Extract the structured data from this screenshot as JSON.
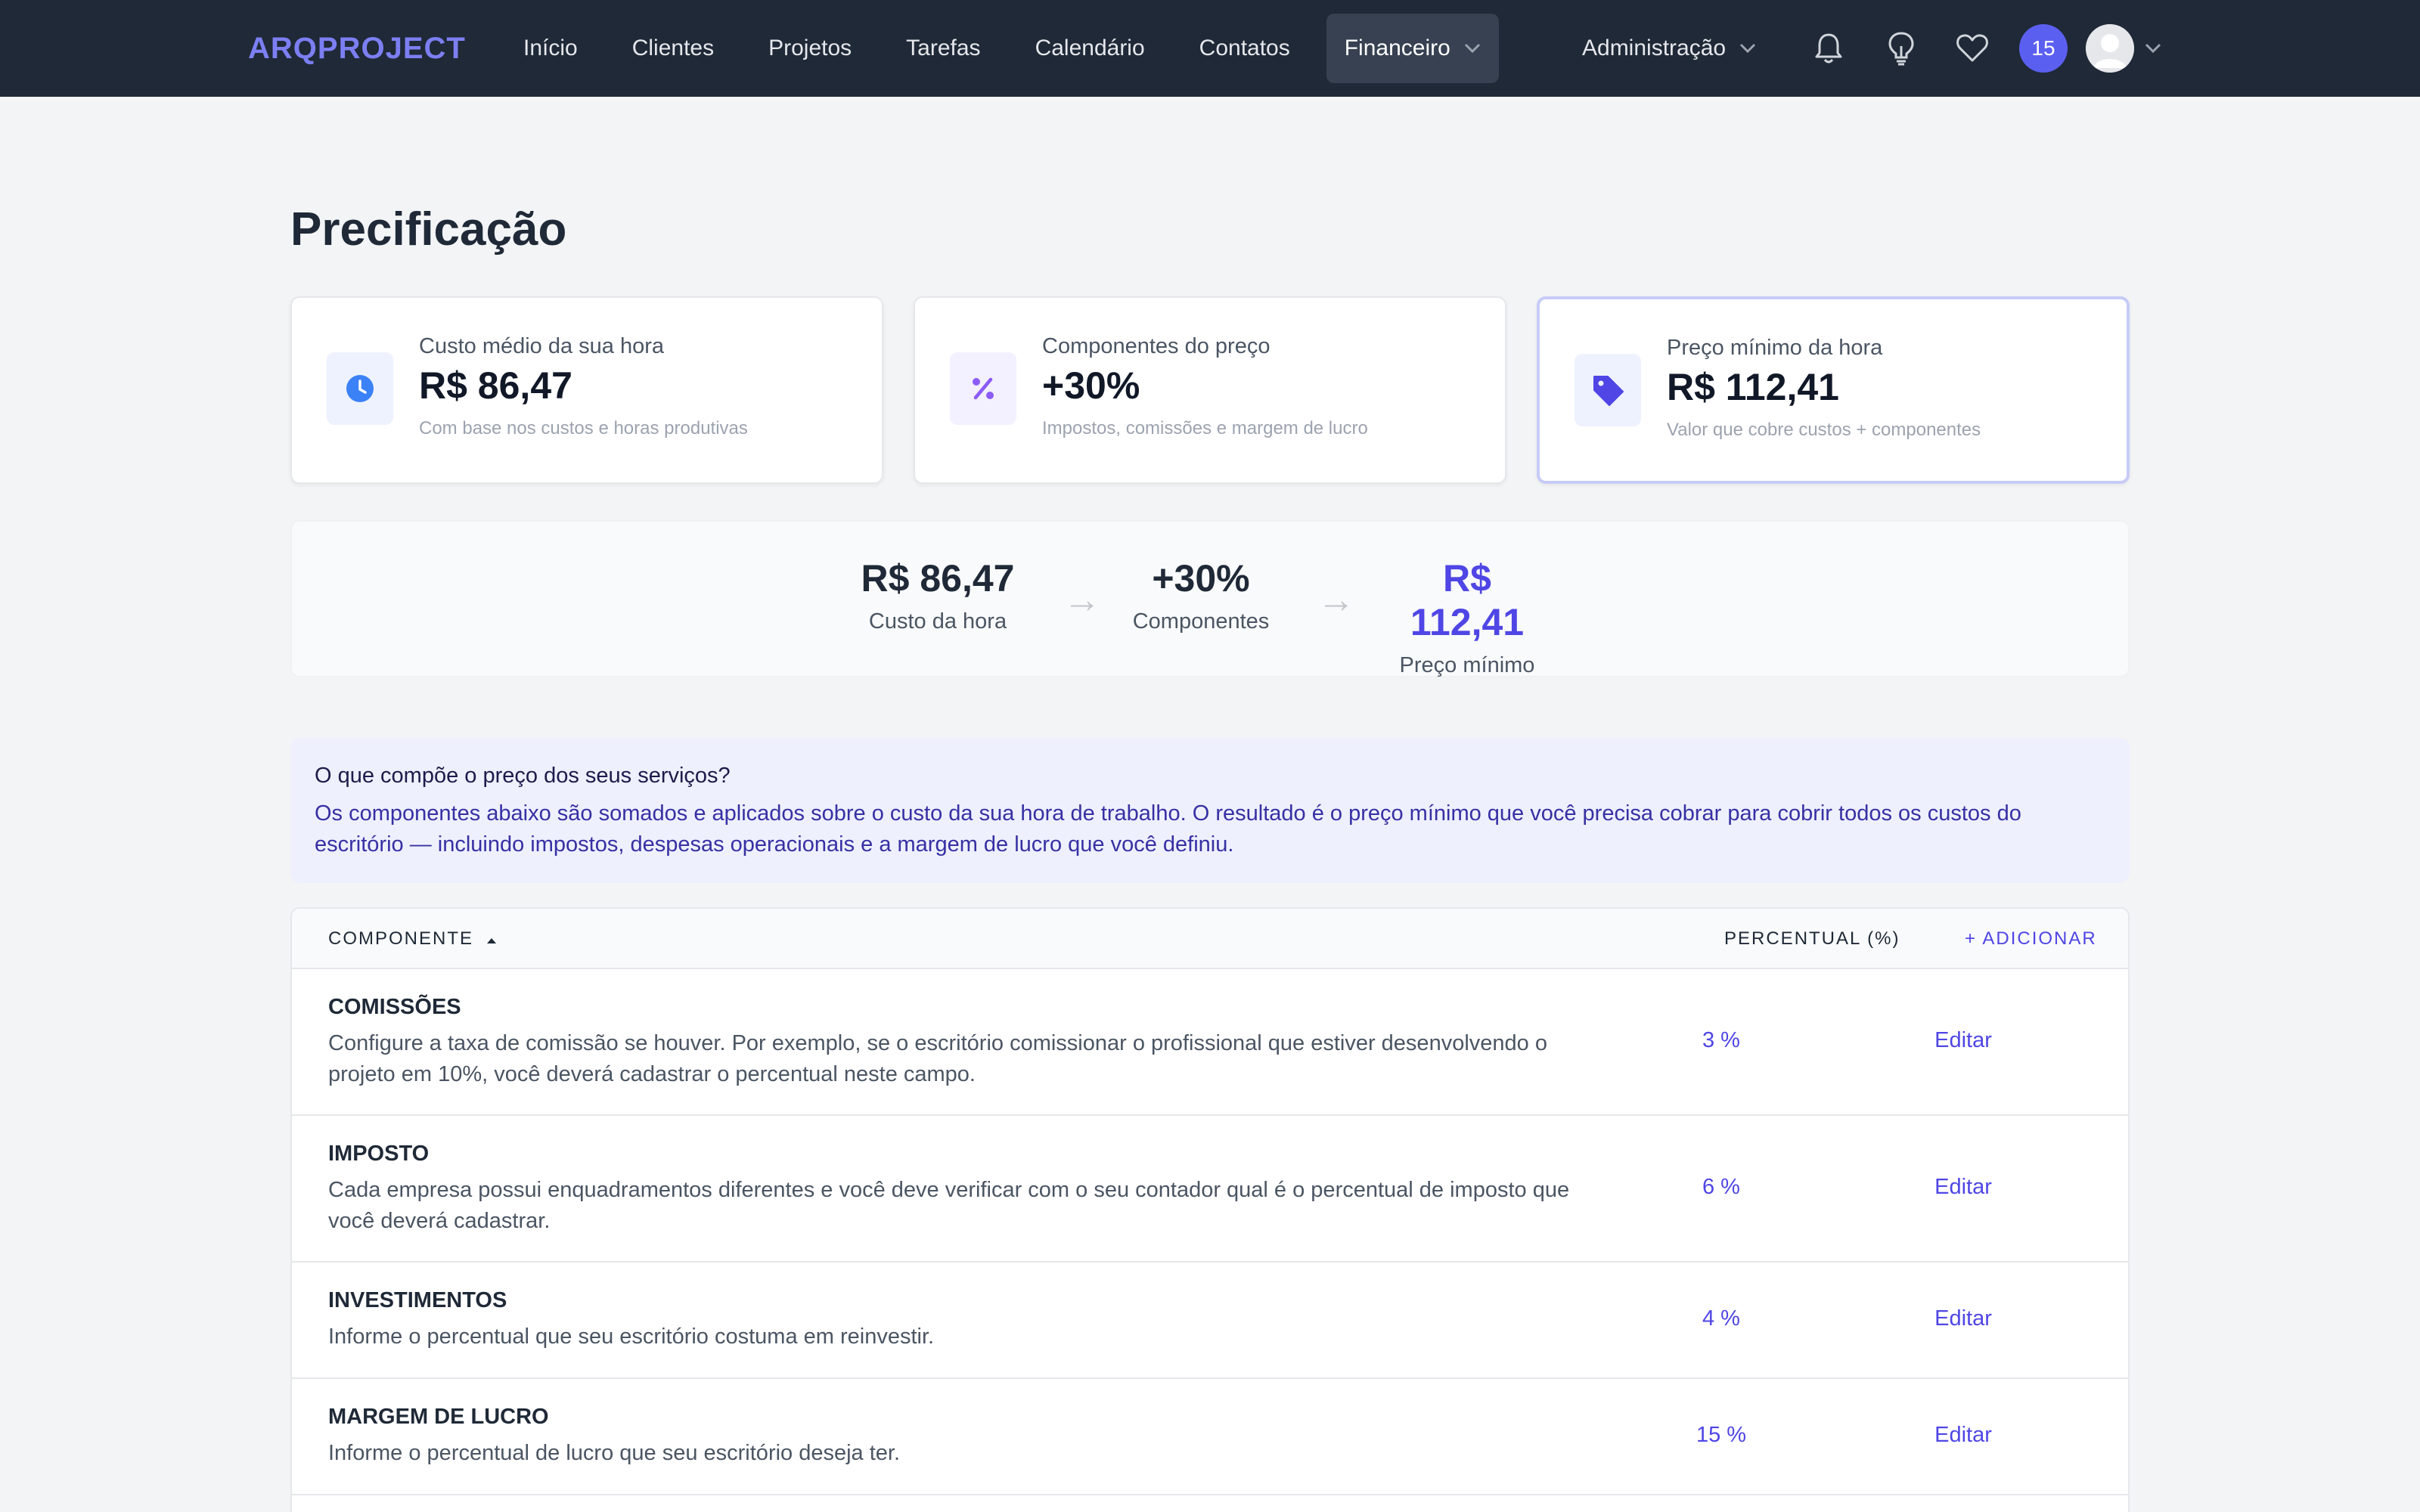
{
  "nav": {
    "logo": "ARQPROJECT",
    "links": [
      "Início",
      "Clientes",
      "Projetos",
      "Tarefas",
      "Calendário",
      "Contatos"
    ],
    "financeiro": "Financeiro",
    "admin": "Administração",
    "notification_count": "15",
    "icons": [
      "bell-icon",
      "lightbulb-icon",
      "heart-icon",
      "user-avatar",
      "chevron-down-icon"
    ]
  },
  "page": {
    "title": "Precificação"
  },
  "cards": [
    {
      "label": "Custo médio da sua hora",
      "value": "R$ 86,47",
      "sub": "Com base nos custos e horas produtivas",
      "icon": "clock-icon",
      "icon_bg": "#eef2ff",
      "icon_color": "#3b82f6"
    },
    {
      "label": "Componentes do preço",
      "value": "+30%",
      "sub": "Impostos, comissões e margem de lucro",
      "icon": "percent-icon",
      "icon_bg": "#f3f0ff",
      "icon_color": "#8b5cf6"
    },
    {
      "label": "Preço mínimo da hora",
      "value": "R$ 112,41",
      "sub": "Valor que cobre custos + componentes",
      "icon": "tag-icon",
      "icon_bg": "#eef2ff",
      "icon_color": "#4f46e5"
    }
  ],
  "formula": {
    "cost_value": "R$ 86,47",
    "cost_label": "Custo da hora",
    "arrow": "→",
    "comp_value": "+30%",
    "comp_label": "Componentes",
    "price_value": "R$ 112,41",
    "price_label": "Preço mínimo"
  },
  "info": {
    "title": "O que compõe o preço dos seus serviços?",
    "body": "Os componentes abaixo são somados e aplicados sobre o custo da sua hora de trabalho. O resultado é o preço mínimo que você precisa cobrar para cobrir todos os custos do escritório — incluindo impostos, despesas operacionais e a margem de lucro que você definiu."
  },
  "table": {
    "col_component": "COMPONENTE",
    "col_percent": "PERCENTUAL (%)",
    "add": "+ ADICIONAR",
    "rows": [
      {
        "title": "COMISSÕES",
        "desc": "Configure a taxa de comissão se houver. Por exemplo, se o escritório comissionar o profissional que estiver desenvolvendo o projeto em 10%, você deverá cadastrar o percentual neste campo.",
        "pct": "3 %",
        "edit": "Editar"
      },
      {
        "title": "IMPOSTO",
        "desc": "Cada empresa possui enquadramentos diferentes e você deve verificar com o seu contador qual é o percentual de imposto que você deverá cadastrar.",
        "pct": "6 %",
        "edit": "Editar"
      },
      {
        "title": "INVESTIMENTOS",
        "desc": "Informe o percentual que seu escritório costuma em reinvestir.",
        "pct": "4 %",
        "edit": "Editar"
      },
      {
        "title": "MARGEM DE LUCRO",
        "desc": "Informe o percentual de lucro que seu escritório deseja ter.",
        "pct": "15 %",
        "edit": "Editar"
      }
    ]
  }
}
